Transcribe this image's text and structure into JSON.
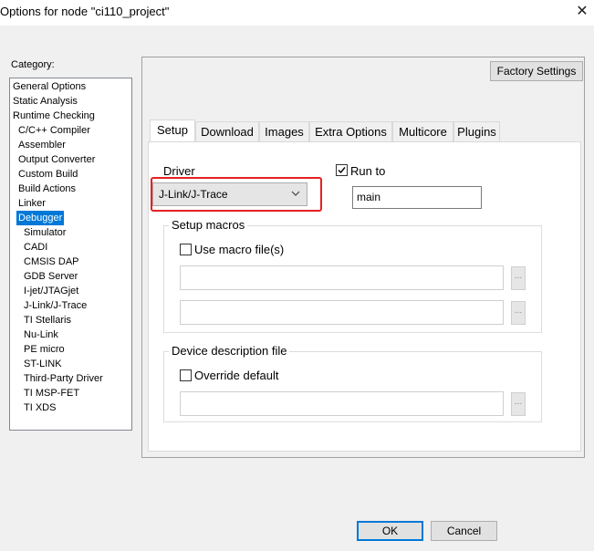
{
  "window": {
    "title": "Options for node \"ci110_project\"",
    "close_icon": "close-icon"
  },
  "sidebar": {
    "label": "Category:",
    "items": [
      {
        "label": "General Options",
        "indent": 0
      },
      {
        "label": "Static Analysis",
        "indent": 0
      },
      {
        "label": "Runtime Checking",
        "indent": 0
      },
      {
        "label": "C/C++ Compiler",
        "indent": 1
      },
      {
        "label": "Assembler",
        "indent": 1
      },
      {
        "label": "Output Converter",
        "indent": 1
      },
      {
        "label": "Custom Build",
        "indent": 1
      },
      {
        "label": "Build Actions",
        "indent": 1
      },
      {
        "label": "Linker",
        "indent": 1
      },
      {
        "label": "Debugger",
        "indent": 1,
        "selected": true
      },
      {
        "label": "Simulator",
        "indent": 2
      },
      {
        "label": "CADI",
        "indent": 2
      },
      {
        "label": "CMSIS DAP",
        "indent": 2
      },
      {
        "label": "GDB Server",
        "indent": 2
      },
      {
        "label": "I-jet/JTAGjet",
        "indent": 2
      },
      {
        "label": "J-Link/J-Trace",
        "indent": 2
      },
      {
        "label": "TI Stellaris",
        "indent": 2
      },
      {
        "label": "Nu-Link",
        "indent": 2
      },
      {
        "label": "PE micro",
        "indent": 2
      },
      {
        "label": "ST-LINK",
        "indent": 2
      },
      {
        "label": "Third-Party Driver",
        "indent": 2
      },
      {
        "label": "TI MSP-FET",
        "indent": 2
      },
      {
        "label": "TI XDS",
        "indent": 2
      }
    ]
  },
  "toolbar": {
    "factory_settings_label": "Factory Settings"
  },
  "tabs": [
    {
      "label": "Setup",
      "active": true
    },
    {
      "label": "Download"
    },
    {
      "label": "Images"
    },
    {
      "label": "Extra Options"
    },
    {
      "label": "Multicore"
    },
    {
      "label": "Plugins"
    }
  ],
  "setup": {
    "driver_label": "Driver",
    "driver_value": "J-Link/J-Trace",
    "run_to_label": "Run to",
    "run_to_checked": true,
    "run_to_value": "main",
    "macros_group": "Setup macros",
    "use_macro_label": "Use macro file(s)",
    "use_macro_checked": false,
    "macro_file_1": "",
    "macro_file_2": "",
    "device_group": "Device description file",
    "override_label": "Override default",
    "override_checked": false,
    "device_file": "",
    "browse_label": "..."
  },
  "footer": {
    "ok_label": "OK",
    "cancel_label": "Cancel"
  },
  "colors": {
    "selection": "#0078d7",
    "highlight_box": "#e62020",
    "panel_bg": "#f0f0f0"
  }
}
